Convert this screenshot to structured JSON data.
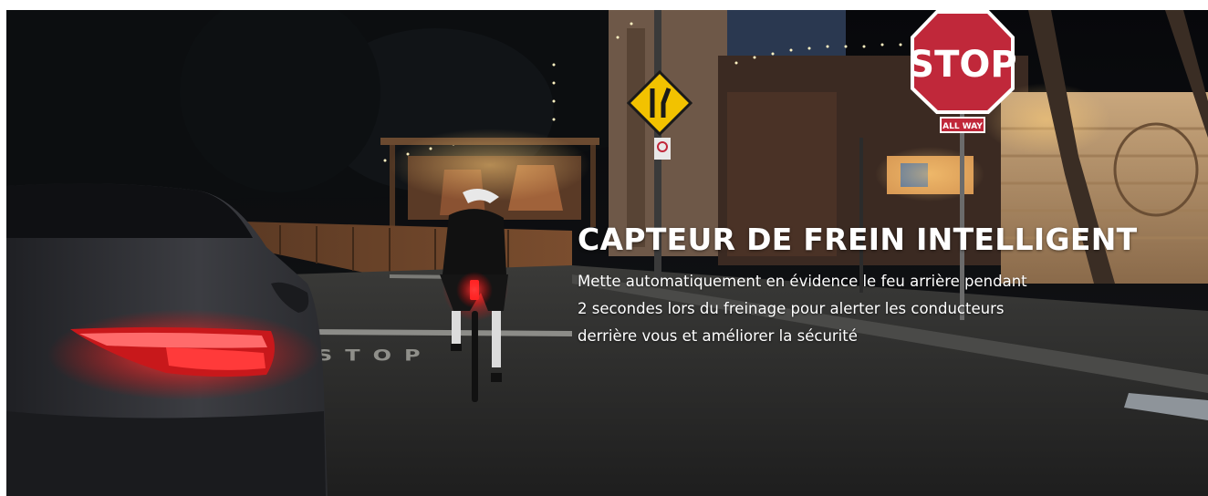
{
  "banner": {
    "title": "CAPTEUR DE FREIN INTELLIGENT",
    "description_lines": [
      "Mette automatiquement en évidence le feu arrière pendant",
      "2 secondes lors du freinage pour alerter les conducteurs",
      "derrière vous et améliorer la sécurité"
    ]
  },
  "scene": {
    "stop_sign_text": "STOP",
    "stop_sign_plate_text": "ALL WAY",
    "road_marking_text": "STOP"
  },
  "colors": {
    "sky": "#0a0b0e",
    "tail_light": "#ff2a2a",
    "stop_sign": "#c0283a",
    "warning_sign": "#f2c200",
    "text": "#ffffff"
  },
  "icons": [
    "stop-sign-icon",
    "road-narrows-warning-sign-icon",
    "no-parking-sign-icon"
  ]
}
